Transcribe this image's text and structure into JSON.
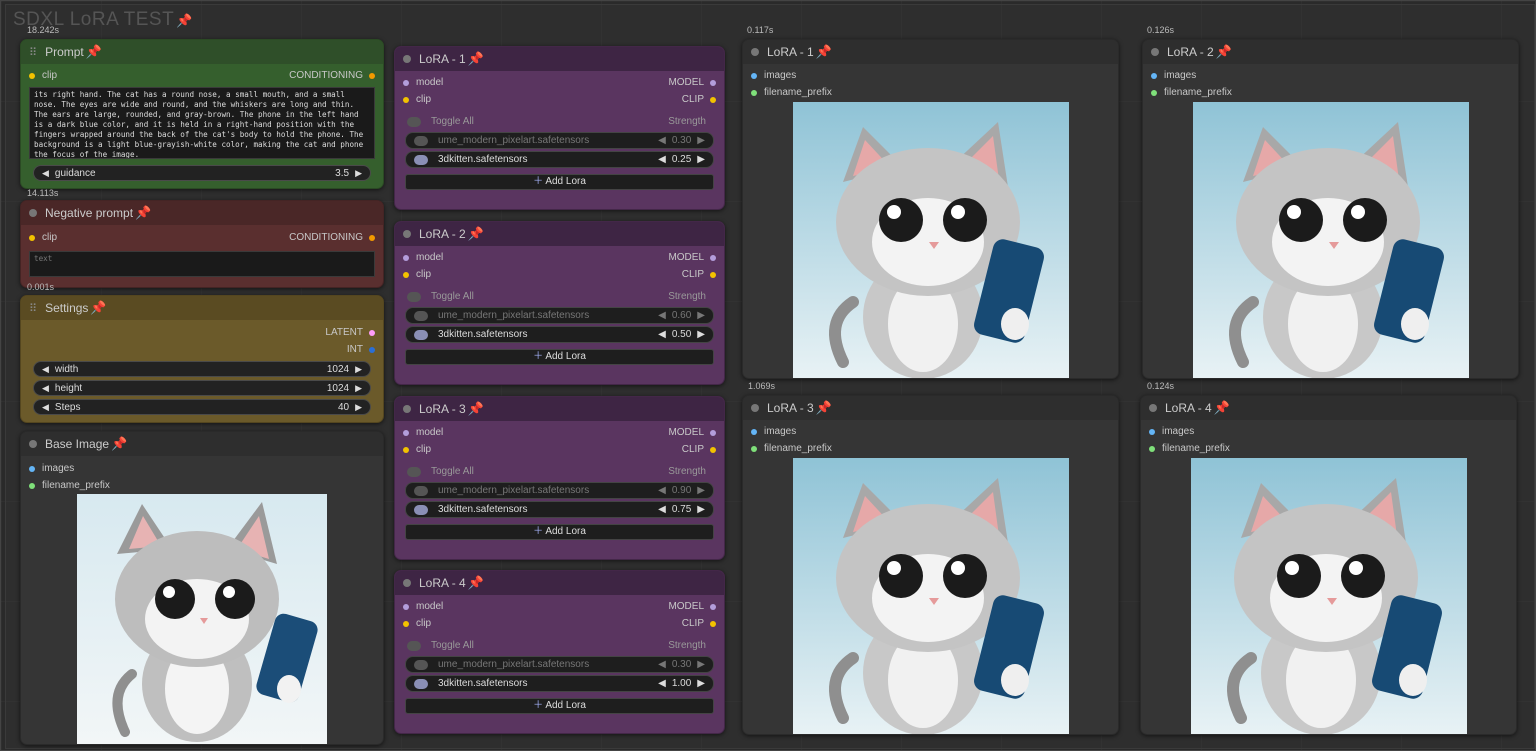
{
  "workflow": {
    "title": "SDXL LoRA TEST"
  },
  "timings": {
    "prompt": "18.242s",
    "neg": "14.113s",
    "settings": "0.001s",
    "preview1": "0.117s",
    "preview2": "0.126s",
    "preview3": "1.069s",
    "preview4": "0.124s"
  },
  "prompt_node": {
    "title": "Prompt",
    "input": "clip",
    "output": "CONDITIONING",
    "text": "its right hand. The cat has a round nose, a small mouth, and a small nose. The eyes are wide and round, and the whiskers are long and thin. The ears are large, rounded, and gray-brown. The phone in the left hand is a dark blue color, and it is held in a right-hand position with the fingers wrapped around the back of the cat's body to hold the phone. The background is a light blue-grayish-white color, making the cat and phone the focus of the image.",
    "guidance_label": "guidance",
    "guidance_value": "3.5"
  },
  "neg_node": {
    "title": "Negative prompt",
    "input": "clip",
    "output": "CONDITIONING",
    "placeholder": "text"
  },
  "settings_node": {
    "title": "Settings",
    "out1": "LATENT",
    "out2": "INT",
    "widgets": [
      {
        "label": "width",
        "value": "1024"
      },
      {
        "label": "height",
        "value": "1024"
      },
      {
        "label": "Steps",
        "value": "40"
      }
    ]
  },
  "base_image": {
    "title": "Base Image",
    "in1": "images",
    "in2": "filename_prefix"
  },
  "lora_common": {
    "in_model": "model",
    "in_clip": "clip",
    "out_model": "MODEL",
    "out_clip": "CLIP",
    "toggle_all": "Toggle All",
    "strength": "Strength",
    "add": "Add Lora",
    "lora_a": "ume_modern_pixelart.safetensors",
    "lora_b": "3dkitten.safetensors"
  },
  "lora_nodes": [
    {
      "title": "LoRA - 1",
      "a_val": "0.30",
      "b_val": "0.25"
    },
    {
      "title": "LoRA - 2",
      "a_val": "0.60",
      "b_val": "0.50"
    },
    {
      "title": "LoRA - 3",
      "a_val": "0.90",
      "b_val": "0.75"
    },
    {
      "title": "LoRA - 4",
      "a_val": "0.30",
      "b_val": "1.00"
    }
  ],
  "previews": [
    {
      "title": "LoRA - 1",
      "in1": "images",
      "in2": "filename_prefix"
    },
    {
      "title": "LoRA - 2",
      "in1": "images",
      "in2": "filename_prefix"
    },
    {
      "title": "LoRA - 3",
      "in1": "images",
      "in2": "filename_prefix"
    },
    {
      "title": "LoRA - 4",
      "in1": "images",
      "in2": "filename_prefix"
    }
  ],
  "colors": {
    "prompt_green": "#355f2d",
    "neg_red": "#5a2f2f",
    "settings_gold": "#6b5a2a",
    "lora_purple": "#5a3560",
    "node_dark": "#353535"
  }
}
